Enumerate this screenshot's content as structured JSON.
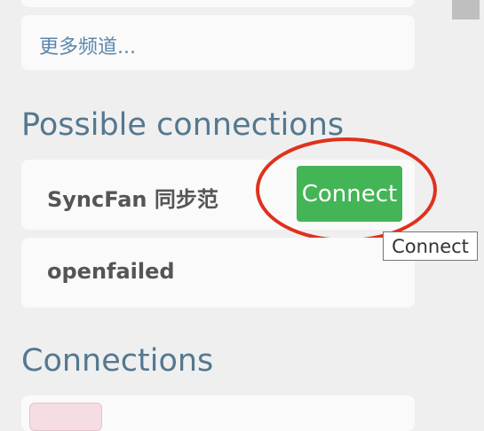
{
  "channels": {
    "more_label": "更多频道..."
  },
  "possible": {
    "title": "Possible connections",
    "items": [
      {
        "name": "SyncFan 同步范",
        "action_label": "Connect"
      },
      {
        "name": "openfailed"
      }
    ]
  },
  "tooltip": {
    "text": "Connect"
  },
  "connections": {
    "title": "Connections"
  },
  "colors": {
    "connect_button": "#43b556",
    "annotation_circle": "#e0311c",
    "section_title": "#54788f",
    "link": "#5b87ad"
  }
}
